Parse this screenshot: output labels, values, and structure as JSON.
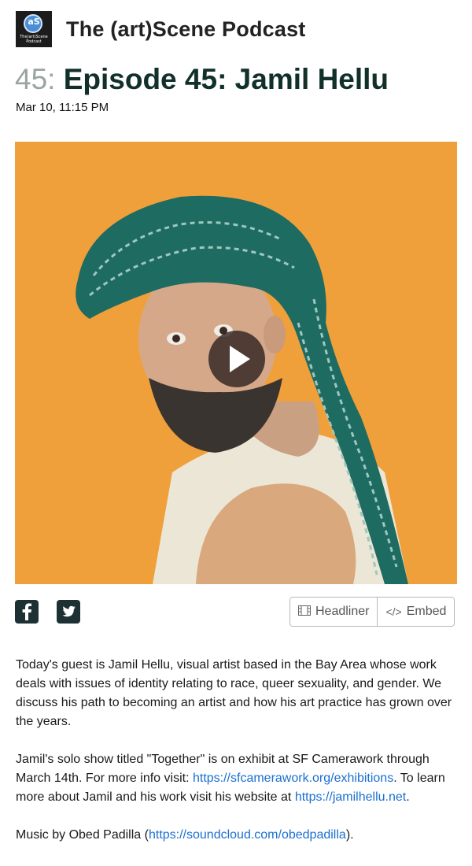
{
  "podcast": {
    "title": "The (art)Scene Podcast",
    "logo_text": "aS",
    "logo_subtext": "The(art)Scene Podcast"
  },
  "episode": {
    "number_label": "45:",
    "title": "Episode 45: Jamil Hellu",
    "date": "Mar 10, 11:15 PM",
    "artwork_colors": {
      "background": "#f0a03a",
      "turban": "#1e6b62"
    }
  },
  "share": {
    "facebook_icon": "facebook-icon",
    "twitter_icon": "twitter-icon"
  },
  "actions": {
    "headliner_label": "Headliner",
    "embed_label": "Embed"
  },
  "description": {
    "p1": "Today's guest is Jamil Hellu, visual artist based in the Bay Area whose work deals with issues of identity relating to race, queer sexuality, and gender. We discuss his path to becoming an artist and how his art practice has grown over the years.",
    "p2_a": "Jamil's solo show titled \"Together\" is on exhibit at SF Camerawork through March 14th. For more info visit: ",
    "p2_link1": "https://sfcamerawork.org/exhibitions",
    "p2_b": ". To learn more about Jamil and his work visit his website at ",
    "p2_link2": "https://jamilhellu.net",
    "p2_c": ".",
    "p3_a": "Music by Obed Padilla (",
    "p3_link": "https://soundcloud.com/obedpadilla",
    "p3_b": ")."
  },
  "colors": {
    "link": "#1a6fd0",
    "title": "#12302a"
  }
}
